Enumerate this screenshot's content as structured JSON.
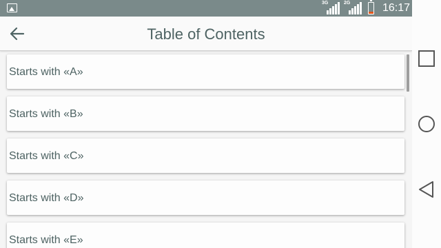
{
  "status_bar": {
    "icons": [
      "picture-icon",
      "signal-3g-icon",
      "signal-2g-icon",
      "battery-icon"
    ],
    "network_1": "3G",
    "network_2": "2G",
    "battery_level": 0.2,
    "time": "16:17"
  },
  "app_bar": {
    "back_icon": "arrow-left-icon",
    "title": "Table of Contents"
  },
  "toc": {
    "items": [
      {
        "label": "Starts with «A»"
      },
      {
        "label": "Starts with «B»"
      },
      {
        "label": "Starts with «C»"
      },
      {
        "label": "Starts with «D»"
      },
      {
        "label": "Starts with «E»"
      }
    ]
  },
  "nav_bar": {
    "buttons": [
      "recent-apps-icon",
      "home-icon",
      "back-triangle-icon"
    ]
  },
  "colors": {
    "status_bar": "#7a8a8a",
    "text": "#4e6363",
    "battery_low": "#e2571e",
    "background": "#f5f5f5"
  }
}
